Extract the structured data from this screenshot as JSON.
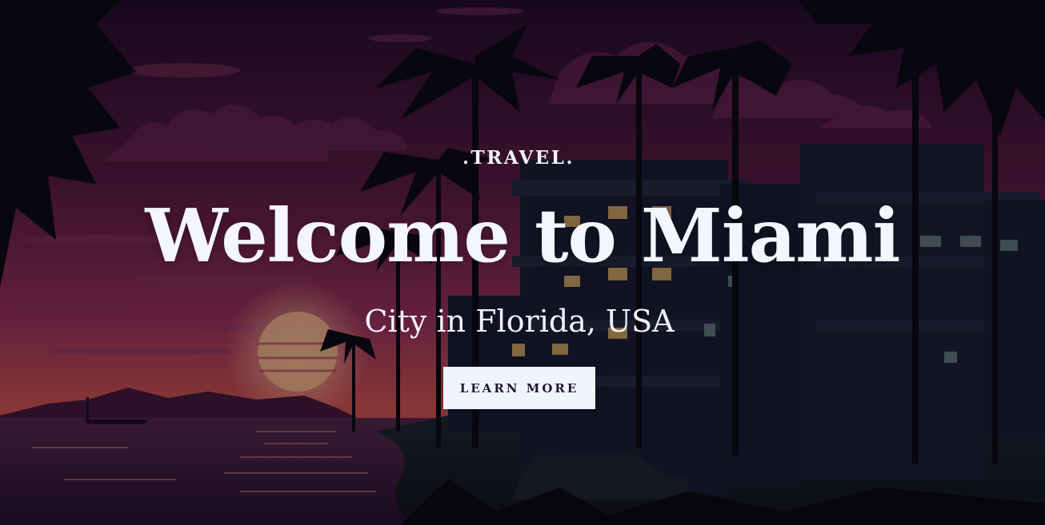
{
  "hero": {
    "eyebrow": ".TRAVEL.",
    "title": "Welcome to Miami",
    "subtitle": "City in Florida, USA",
    "cta_label": "LEARN MORE"
  },
  "theme": {
    "sky_top": "#1d0b24",
    "sky_mid": "#4d1736",
    "sky_glow": "#8a2e4d",
    "horizon": "#b84c45",
    "sea": "#2f1833",
    "sun": "#e6b98a",
    "button_bg": "#f1f4ff",
    "button_text": "#1e1830",
    "text_color": "#f3f5ff"
  }
}
